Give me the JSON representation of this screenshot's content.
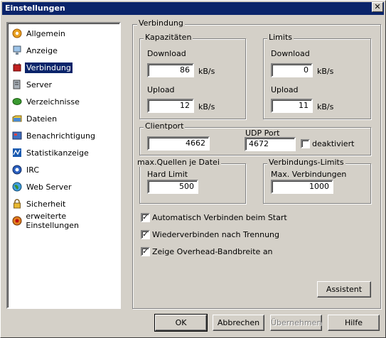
{
  "window": {
    "title": "Einstellungen",
    "close_symbol": "✕"
  },
  "sidebar": {
    "items": [
      {
        "label": "Allgemein",
        "icon": "gear-icon"
      },
      {
        "label": "Anzeige",
        "icon": "display-icon"
      },
      {
        "label": "Verbindung",
        "icon": "connection-icon",
        "selected": true
      },
      {
        "label": "Server",
        "icon": "server-icon"
      },
      {
        "label": "Verzeichnisse",
        "icon": "folder-icon"
      },
      {
        "label": "Dateien",
        "icon": "files-icon"
      },
      {
        "label": "Benachrichtigung",
        "icon": "notification-icon"
      },
      {
        "label": "Statistikanzeige",
        "icon": "statistics-icon"
      },
      {
        "label": "IRC",
        "icon": "irc-icon"
      },
      {
        "label": "Web Server",
        "icon": "globe-icon"
      },
      {
        "label": "Sicherheit",
        "icon": "lock-icon"
      },
      {
        "label": "erweiterte Einstellungen",
        "icon": "advanced-icon"
      }
    ]
  },
  "main": {
    "group_title": "Verbindung",
    "capacities": {
      "title": "Kapazitäten",
      "download_label": "Download",
      "download_value": "86",
      "download_unit": "kB/s",
      "upload_label": "Upload",
      "upload_value": "12",
      "upload_unit": "kB/s"
    },
    "limits": {
      "title": "Limits",
      "download_label": "Download",
      "download_value": "0",
      "download_unit": "kB/s",
      "upload_label": "Upload",
      "upload_value": "11",
      "upload_unit": "kB/s"
    },
    "clientport": {
      "title": "Clientport",
      "value": "4662",
      "udp_label": "UDP Port",
      "udp_value": "4672",
      "disabled_label": "deaktiviert",
      "disabled_checked": false
    },
    "max_sources": {
      "title": "max.Quellen je Datei",
      "hard_limit_label": "Hard Limit",
      "hard_limit_value": "500"
    },
    "connection_limits": {
      "title": "Verbindungs-Limits",
      "max_conn_label": "Max. Verbindungen",
      "max_conn_value": "1000"
    },
    "options": [
      {
        "label": "Automatisch Verbinden beim Start",
        "checked": true
      },
      {
        "label": "Wiederverbinden nach Trennung",
        "checked": true
      },
      {
        "label": "Zeige Overhead-Bandbreite an",
        "checked": true
      }
    ],
    "wizard_button": "Assistent"
  },
  "footer": {
    "ok": "OK",
    "cancel": "Abbrechen",
    "apply": "Übernehmen",
    "help": "Hilfe"
  }
}
